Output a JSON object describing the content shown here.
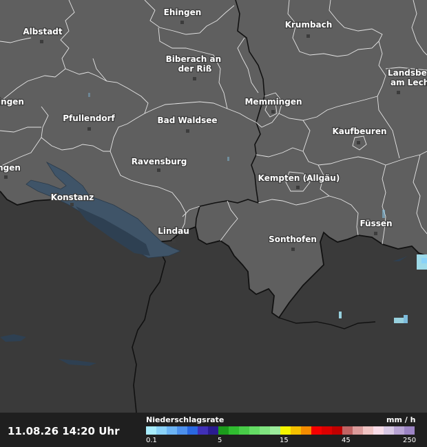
{
  "map": {
    "cities": [
      {
        "name": "Ehingen",
        "lines": [
          "Ehingen"
        ]
      },
      {
        "name": "Albstadt",
        "lines": [
          "Albstadt"
        ]
      },
      {
        "name": "Krumbach",
        "lines": [
          "Krumbach"
        ]
      },
      {
        "name": "Biberach an der Riß",
        "lines": [
          "Biberach an",
          "der Riß"
        ]
      },
      {
        "name": "Landsberg am Lech",
        "lines": [
          "Landsbe",
          "am Lech"
        ]
      },
      {
        "name": "Memmingen",
        "lines": [
          "Memmingen"
        ]
      },
      {
        "name": "Pfullendorf",
        "lines": [
          "Pfullendorf"
        ]
      },
      {
        "name": "Bad Waldsee",
        "lines": [
          "Bad Waldsee"
        ]
      },
      {
        "name": "Kaufbeuren",
        "lines": [
          "Kaufbeuren"
        ]
      },
      {
        "name": "Ravensburg",
        "lines": [
          "Ravensburg"
        ]
      },
      {
        "name": "Kempten (Allgäu)",
        "lines": [
          "Kempten (Allgäu)"
        ]
      },
      {
        "name": "Konstanz",
        "lines": [
          "Konstanz"
        ]
      },
      {
        "name": "Füssen",
        "lines": [
          "Füssen"
        ]
      },
      {
        "name": "Lindau",
        "lines": [
          "Lindau"
        ]
      },
      {
        "name": "Sonthofen",
        "lines": [
          "Sonthofen"
        ]
      },
      {
        "name": "Sigmaringen (partial)",
        "lines": [
          "ingen"
        ]
      },
      {
        "name": "Singen (partial)",
        "lines": [
          "ngen"
        ]
      }
    ]
  },
  "footer": {
    "timestamp": "11.08.26 14:20 Uhr",
    "legend_title": "Niederschlagsrate",
    "legend_unit": "mm / h",
    "legend_ticks": [
      "0.1",
      "5",
      "15",
      "45",
      "250"
    ],
    "legend_colors": [
      "#a8ecfc",
      "#8ad2f8",
      "#6cb4f4",
      "#4c90ec",
      "#2a68e0",
      "#4030b8",
      "#2a1c90",
      "#1c9c1c",
      "#30bc30",
      "#48cc48",
      "#64dc64",
      "#80e480",
      "#9cec9c",
      "#f4f400",
      "#f4c000",
      "#f48c00",
      "#f40000",
      "#dc0000",
      "#c00000",
      "#c06464",
      "#dc9c9c",
      "#f0c4c4",
      "#f8dce8",
      "#d8c8e4",
      "#b8a4d4",
      "#9c84c4"
    ]
  }
}
